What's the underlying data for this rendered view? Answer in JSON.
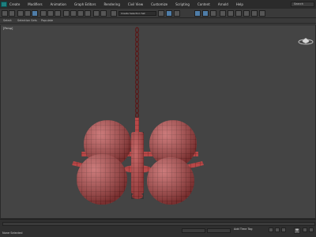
{
  "menubar": {
    "items": [
      "Create",
      "Modifiers",
      "Animation",
      "Graph Editors",
      "Rendering",
      "Civil View",
      "Customize",
      "Scripting",
      "Content",
      "Arnold",
      "Help"
    ],
    "search_placeholder": "Search"
  },
  "toolbar": {
    "dropdown_label": "Create Selection Set"
  },
  "ribbon": {
    "items": [
      "Select",
      "Selection Sets",
      "Populate"
    ]
  },
  "viewport": {
    "label": "[Persp]",
    "object_color": "#b84848",
    "wire_color": "#5a1616"
  },
  "status": {
    "left_text": "None Selected",
    "right_text": "Add Time Tag",
    "frame_text": "Auto"
  },
  "icons": [
    "app-icon",
    "search-icon",
    "viewcube-icon",
    "plus-icon"
  ]
}
